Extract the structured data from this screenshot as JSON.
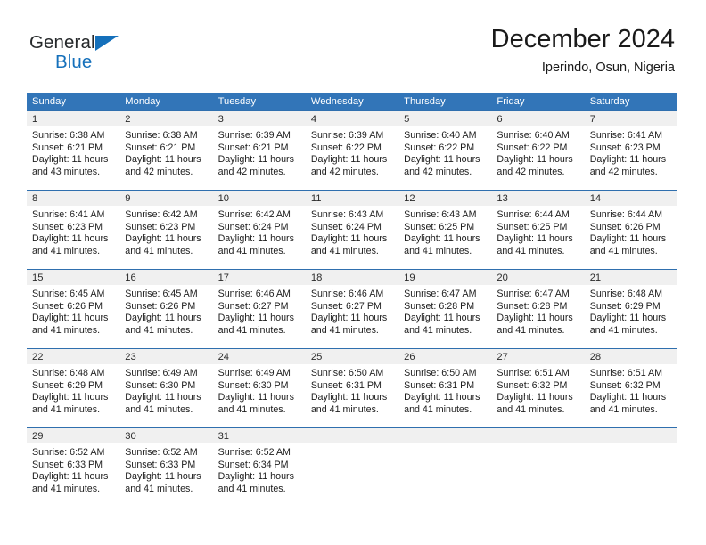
{
  "branding": {
    "name_part1": "General",
    "name_part2": "Blue",
    "triangle_icon": "logo-triangle",
    "accent_color": "#1570bb"
  },
  "header": {
    "title": "December 2024",
    "location": "Iperindo, Osun, Nigeria"
  },
  "theme": {
    "header_blue": "#3275b8",
    "row_divider": "#2f6fae",
    "daynum_band": "#f0f0f0",
    "text": "#1d1d1d"
  },
  "weekdays": [
    "Sunday",
    "Monday",
    "Tuesday",
    "Wednesday",
    "Thursday",
    "Friday",
    "Saturday"
  ],
  "weeks": [
    [
      {
        "day": "1",
        "sunrise": "Sunrise: 6:38 AM",
        "sunset": "Sunset: 6:21 PM",
        "daylight1": "Daylight: 11 hours",
        "daylight2": "and 43 minutes."
      },
      {
        "day": "2",
        "sunrise": "Sunrise: 6:38 AM",
        "sunset": "Sunset: 6:21 PM",
        "daylight1": "Daylight: 11 hours",
        "daylight2": "and 42 minutes."
      },
      {
        "day": "3",
        "sunrise": "Sunrise: 6:39 AM",
        "sunset": "Sunset: 6:21 PM",
        "daylight1": "Daylight: 11 hours",
        "daylight2": "and 42 minutes."
      },
      {
        "day": "4",
        "sunrise": "Sunrise: 6:39 AM",
        "sunset": "Sunset: 6:22 PM",
        "daylight1": "Daylight: 11 hours",
        "daylight2": "and 42 minutes."
      },
      {
        "day": "5",
        "sunrise": "Sunrise: 6:40 AM",
        "sunset": "Sunset: 6:22 PM",
        "daylight1": "Daylight: 11 hours",
        "daylight2": "and 42 minutes."
      },
      {
        "day": "6",
        "sunrise": "Sunrise: 6:40 AM",
        "sunset": "Sunset: 6:22 PM",
        "daylight1": "Daylight: 11 hours",
        "daylight2": "and 42 minutes."
      },
      {
        "day": "7",
        "sunrise": "Sunrise: 6:41 AM",
        "sunset": "Sunset: 6:23 PM",
        "daylight1": "Daylight: 11 hours",
        "daylight2": "and 42 minutes."
      }
    ],
    [
      {
        "day": "8",
        "sunrise": "Sunrise: 6:41 AM",
        "sunset": "Sunset: 6:23 PM",
        "daylight1": "Daylight: 11 hours",
        "daylight2": "and 41 minutes."
      },
      {
        "day": "9",
        "sunrise": "Sunrise: 6:42 AM",
        "sunset": "Sunset: 6:23 PM",
        "daylight1": "Daylight: 11 hours",
        "daylight2": "and 41 minutes."
      },
      {
        "day": "10",
        "sunrise": "Sunrise: 6:42 AM",
        "sunset": "Sunset: 6:24 PM",
        "daylight1": "Daylight: 11 hours",
        "daylight2": "and 41 minutes."
      },
      {
        "day": "11",
        "sunrise": "Sunrise: 6:43 AM",
        "sunset": "Sunset: 6:24 PM",
        "daylight1": "Daylight: 11 hours",
        "daylight2": "and 41 minutes."
      },
      {
        "day": "12",
        "sunrise": "Sunrise: 6:43 AM",
        "sunset": "Sunset: 6:25 PM",
        "daylight1": "Daylight: 11 hours",
        "daylight2": "and 41 minutes."
      },
      {
        "day": "13",
        "sunrise": "Sunrise: 6:44 AM",
        "sunset": "Sunset: 6:25 PM",
        "daylight1": "Daylight: 11 hours",
        "daylight2": "and 41 minutes."
      },
      {
        "day": "14",
        "sunrise": "Sunrise: 6:44 AM",
        "sunset": "Sunset: 6:26 PM",
        "daylight1": "Daylight: 11 hours",
        "daylight2": "and 41 minutes."
      }
    ],
    [
      {
        "day": "15",
        "sunrise": "Sunrise: 6:45 AM",
        "sunset": "Sunset: 6:26 PM",
        "daylight1": "Daylight: 11 hours",
        "daylight2": "and 41 minutes."
      },
      {
        "day": "16",
        "sunrise": "Sunrise: 6:45 AM",
        "sunset": "Sunset: 6:26 PM",
        "daylight1": "Daylight: 11 hours",
        "daylight2": "and 41 minutes."
      },
      {
        "day": "17",
        "sunrise": "Sunrise: 6:46 AM",
        "sunset": "Sunset: 6:27 PM",
        "daylight1": "Daylight: 11 hours",
        "daylight2": "and 41 minutes."
      },
      {
        "day": "18",
        "sunrise": "Sunrise: 6:46 AM",
        "sunset": "Sunset: 6:27 PM",
        "daylight1": "Daylight: 11 hours",
        "daylight2": "and 41 minutes."
      },
      {
        "day": "19",
        "sunrise": "Sunrise: 6:47 AM",
        "sunset": "Sunset: 6:28 PM",
        "daylight1": "Daylight: 11 hours",
        "daylight2": "and 41 minutes."
      },
      {
        "day": "20",
        "sunrise": "Sunrise: 6:47 AM",
        "sunset": "Sunset: 6:28 PM",
        "daylight1": "Daylight: 11 hours",
        "daylight2": "and 41 minutes."
      },
      {
        "day": "21",
        "sunrise": "Sunrise: 6:48 AM",
        "sunset": "Sunset: 6:29 PM",
        "daylight1": "Daylight: 11 hours",
        "daylight2": "and 41 minutes."
      }
    ],
    [
      {
        "day": "22",
        "sunrise": "Sunrise: 6:48 AM",
        "sunset": "Sunset: 6:29 PM",
        "daylight1": "Daylight: 11 hours",
        "daylight2": "and 41 minutes."
      },
      {
        "day": "23",
        "sunrise": "Sunrise: 6:49 AM",
        "sunset": "Sunset: 6:30 PM",
        "daylight1": "Daylight: 11 hours",
        "daylight2": "and 41 minutes."
      },
      {
        "day": "24",
        "sunrise": "Sunrise: 6:49 AM",
        "sunset": "Sunset: 6:30 PM",
        "daylight1": "Daylight: 11 hours",
        "daylight2": "and 41 minutes."
      },
      {
        "day": "25",
        "sunrise": "Sunrise: 6:50 AM",
        "sunset": "Sunset: 6:31 PM",
        "daylight1": "Daylight: 11 hours",
        "daylight2": "and 41 minutes."
      },
      {
        "day": "26",
        "sunrise": "Sunrise: 6:50 AM",
        "sunset": "Sunset: 6:31 PM",
        "daylight1": "Daylight: 11 hours",
        "daylight2": "and 41 minutes."
      },
      {
        "day": "27",
        "sunrise": "Sunrise: 6:51 AM",
        "sunset": "Sunset: 6:32 PM",
        "daylight1": "Daylight: 11 hours",
        "daylight2": "and 41 minutes."
      },
      {
        "day": "28",
        "sunrise": "Sunrise: 6:51 AM",
        "sunset": "Sunset: 6:32 PM",
        "daylight1": "Daylight: 11 hours",
        "daylight2": "and 41 minutes."
      }
    ],
    [
      {
        "day": "29",
        "sunrise": "Sunrise: 6:52 AM",
        "sunset": "Sunset: 6:33 PM",
        "daylight1": "Daylight: 11 hours",
        "daylight2": "and 41 minutes."
      },
      {
        "day": "30",
        "sunrise": "Sunrise: 6:52 AM",
        "sunset": "Sunset: 6:33 PM",
        "daylight1": "Daylight: 11 hours",
        "daylight2": "and 41 minutes."
      },
      {
        "day": "31",
        "sunrise": "Sunrise: 6:52 AM",
        "sunset": "Sunset: 6:34 PM",
        "daylight1": "Daylight: 11 hours",
        "daylight2": "and 41 minutes."
      },
      {
        "day": "",
        "sunrise": "",
        "sunset": "",
        "daylight1": "",
        "daylight2": ""
      },
      {
        "day": "",
        "sunrise": "",
        "sunset": "",
        "daylight1": "",
        "daylight2": ""
      },
      {
        "day": "",
        "sunrise": "",
        "sunset": "",
        "daylight1": "",
        "daylight2": ""
      },
      {
        "day": "",
        "sunrise": "",
        "sunset": "",
        "daylight1": "",
        "daylight2": ""
      }
    ]
  ]
}
